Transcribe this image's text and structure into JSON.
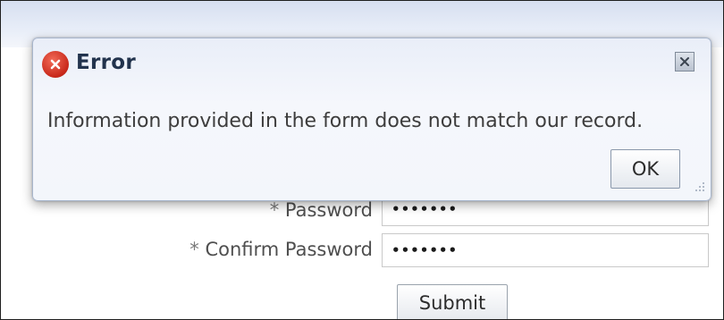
{
  "dialog": {
    "title": "Error",
    "title_icon": "error-icon",
    "close_icon": "close-icon",
    "message": "Information provided in the form does not match our record.",
    "ok_label": "OK",
    "colors": {
      "title": "#22334d",
      "icon": "#c8281a"
    }
  },
  "form": {
    "password": {
      "label": "Password",
      "required_marker": "*",
      "value": "•••••••"
    },
    "confirm_password": {
      "label": "Confirm Password",
      "required_marker": "*",
      "value": "•••••••"
    },
    "submit_label": "Submit"
  }
}
